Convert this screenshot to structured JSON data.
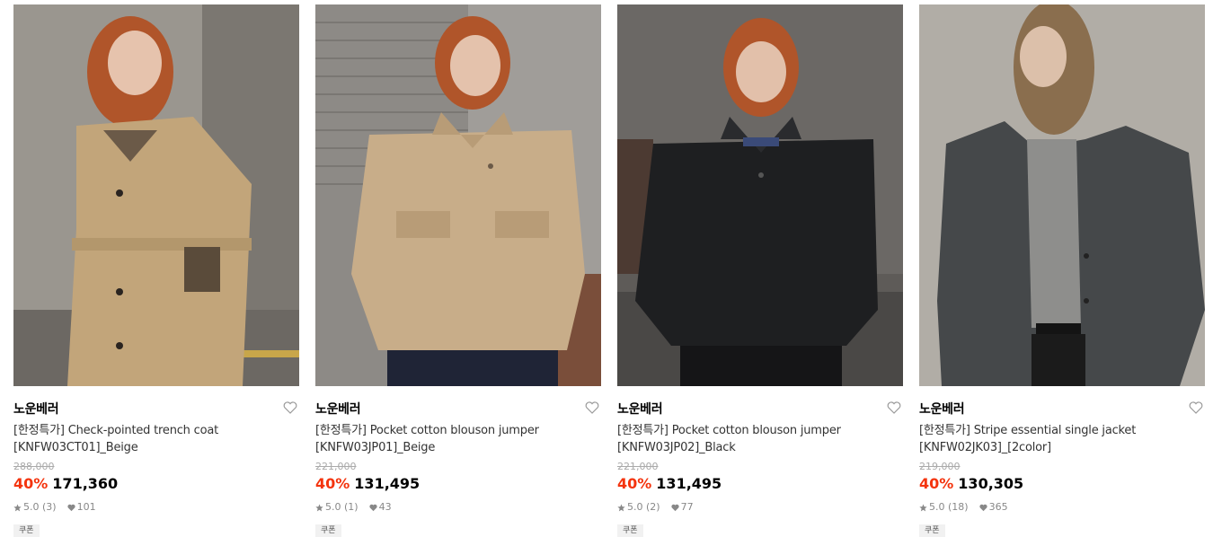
{
  "products": [
    {
      "brand": "노운베러",
      "name_line1": "[한정특가] Check-pointed trench coat",
      "name_line2": "[KNFW03CT01]_Beige",
      "original_price": "288,000",
      "discount": "40%",
      "price": "171,360",
      "rating": "5.0",
      "reviews": "(3)",
      "likes": "101",
      "coupon": "쿠폰",
      "image": "woman-in-beige-trench-coat"
    },
    {
      "brand": "노운베러",
      "name_line1": "[한정특가] Pocket cotton blouson jumper",
      "name_line2": "[KNFW03JP01]_Beige",
      "original_price": "221,000",
      "discount": "40%",
      "price": "131,495",
      "rating": "5.0",
      "reviews": "(1)",
      "likes": "43",
      "coupon": "쿠폰",
      "image": "woman-in-beige-blouson-jumper"
    },
    {
      "brand": "노운베러",
      "name_line1": "[한정특가] Pocket cotton blouson jumper",
      "name_line2": "[KNFW03JP02]_Black",
      "original_price": "221,000",
      "discount": "40%",
      "price": "131,495",
      "rating": "5.0",
      "reviews": "(2)",
      "likes": "77",
      "coupon": "쿠폰",
      "image": "woman-in-black-blouson-jumper"
    },
    {
      "brand": "노운베러",
      "name_line1": "[한정특가] Stripe essential single jacket",
      "name_line2": "[KNFW02JK03]_[2color]",
      "original_price": "219,000",
      "discount": "40%",
      "price": "130,305",
      "rating": "5.0",
      "reviews": "(18)",
      "likes": "365",
      "coupon": "쿠폰",
      "image": "woman-in-grey-stripe-jacket"
    }
  ],
  "colors": {
    "discount": "#f4340e",
    "price": "#000000",
    "muted": "#888888"
  },
  "icons": {
    "wishlist": "heart-outline-icon",
    "rating": "star-icon",
    "likes": "heart-filled-icon"
  }
}
